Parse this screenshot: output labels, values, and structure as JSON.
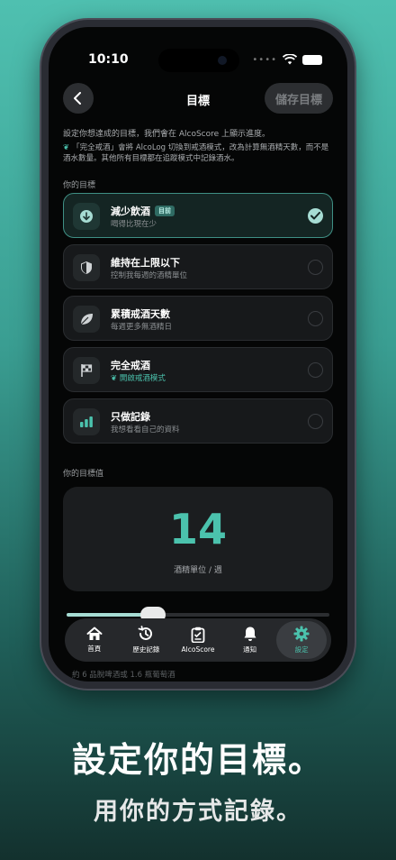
{
  "status": {
    "time": "10:10",
    "signal_dots": "••••"
  },
  "nav": {
    "title": "目標",
    "save_label": "儲存目標"
  },
  "description": "設定你想達成的目標，我們會在 AlcoScore 上顯示進度。",
  "note": "「完全戒酒」會將 AlcoLog 切換到戒酒模式，改為計算無酒精天數，而不是酒水數量。其他所有目標都在追蹤模式中記錄酒水。",
  "goals_label": "你的目標",
  "goals": [
    {
      "title": "減少飲酒",
      "badge": "目前",
      "subtitle": "喝得比現在少",
      "icon": "arrow-down-icon",
      "selected": true
    },
    {
      "title": "維持在上限以下",
      "badge": "",
      "subtitle": "控制我每週的酒精單位",
      "icon": "shield-icon",
      "selected": false
    },
    {
      "title": "累積戒酒天數",
      "badge": "",
      "subtitle": "每週更多無酒精日",
      "icon": "leaf-icon",
      "selected": false
    },
    {
      "title": "完全戒酒",
      "badge": "",
      "subtitle": "開啟戒酒模式",
      "icon": "flag-icon",
      "selected": false
    },
    {
      "title": "只做記錄",
      "badge": "",
      "subtitle": "我想看看自己的資料",
      "icon": "bar-chart-icon",
      "selected": false
    }
  ],
  "target_label": "你的目標值",
  "target": {
    "value": "14",
    "unit": "酒精單位 / 週"
  },
  "slider": {
    "fraction": 0.33
  },
  "tabs": [
    {
      "label": "首頁",
      "icon": "home-icon",
      "active": false
    },
    {
      "label": "歷史記錄",
      "icon": "history-icon",
      "active": false
    },
    {
      "label": "AlcoScore",
      "icon": "clipboard-icon",
      "active": false
    },
    {
      "label": "通知",
      "icon": "bell-icon",
      "active": false
    },
    {
      "label": "設定",
      "icon": "gear-icon",
      "active": true
    }
  ],
  "hint": "約 6 品脫啤酒或 1.6 瓶葡萄酒",
  "headline": "設定你的目標。",
  "subline": "用你的方式記錄。",
  "colors": {
    "accent": "#4bc2ad",
    "background": "#050606",
    "card": "#1b1d1f"
  }
}
